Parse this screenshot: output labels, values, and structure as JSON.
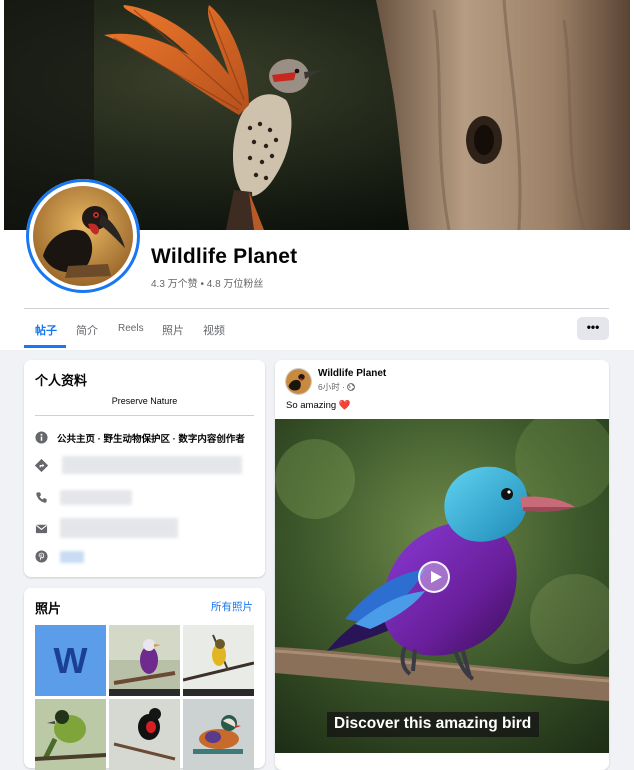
{
  "page": {
    "title": "Wildlife Planet",
    "stats": "4.3 万个赞 • 4.8 万位粉丝"
  },
  "tabs": [
    {
      "label": "帖子",
      "active": true
    },
    {
      "label": "简介",
      "active": false
    },
    {
      "label": "Reels",
      "active": false
    },
    {
      "label": "照片",
      "active": false
    },
    {
      "label": "视频",
      "active": false
    }
  ],
  "more_button": {
    "label": "•••"
  },
  "intro": {
    "title": "个人资料",
    "bio": "Preserve Nature",
    "category": "公共主页 · 野生动物保护区 · 数字内容创作者",
    "rows": [
      {
        "icon": "info-icon"
      },
      {
        "icon": "directions-icon"
      },
      {
        "icon": "phone-icon"
      },
      {
        "icon": "email-icon"
      },
      {
        "icon": "pinterest-icon"
      }
    ]
  },
  "photos": {
    "title": "照片",
    "see_all": "所有照片",
    "thumbs": [
      {
        "icon": "workplace-logo-icon",
        "letter": "W"
      },
      {
        "icon": "purple-bird-photo"
      },
      {
        "icon": "yellow-bird-photo"
      },
      {
        "icon": "green-bird-photo"
      },
      {
        "icon": "red-breasted-bird-photo"
      },
      {
        "icon": "mandarin-duck-photo"
      }
    ]
  },
  "post": {
    "author": "Wildlife Planet",
    "time": "6小时 · ",
    "text": "So amazing ❤️",
    "caption": "Discover this amazing bird"
  },
  "colors": {
    "accent": "#1877f2",
    "background": "#f0f2f5",
    "secondary_text": "#65676b"
  }
}
